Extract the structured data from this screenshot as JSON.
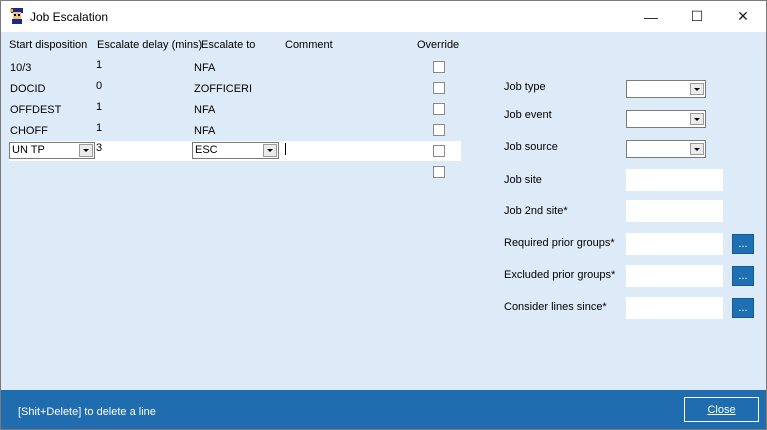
{
  "window": {
    "title": "Job Escalation",
    "controls": {
      "minimize": "—",
      "maximize": "☐",
      "close": "✕"
    }
  },
  "grid": {
    "headers": {
      "start_disposition": "Start disposition",
      "escalate_delay": "Escalate delay (mins)",
      "escalate_to": "Escalate to",
      "comment": "Comment",
      "override": "Override"
    },
    "rows": [
      {
        "start": "10/3",
        "delay": "1",
        "to": "NFA",
        "comment": "",
        "override": false
      },
      {
        "start": "DOCID",
        "delay": "0",
        "to": "ZOFFICERI",
        "comment": "",
        "override": false
      },
      {
        "start": "OFFDEST",
        "delay": "1",
        "to": "NFA",
        "comment": "",
        "override": false
      },
      {
        "start": "CHOFF",
        "delay": "1",
        "to": "NFA",
        "comment": "",
        "override": false
      }
    ],
    "edit_row": {
      "start": "UN TP",
      "delay": "3",
      "to": "ESC",
      "comment": "",
      "override": false
    },
    "new_row": {
      "override": false
    }
  },
  "filters": {
    "job_type": {
      "label": "Job type",
      "value": ""
    },
    "job_event": {
      "label": "Job event",
      "value": ""
    },
    "job_source": {
      "label": "Job source",
      "value": ""
    },
    "job_site": {
      "label": "Job site",
      "value": ""
    },
    "job_2nd_site": {
      "label": "Job 2nd site*",
      "value": ""
    },
    "required_prior_groups": {
      "label": "Required prior groups*",
      "value": "",
      "button": "..."
    },
    "excluded_prior_groups": {
      "label": "Excluded prior groups*",
      "value": "",
      "button": "..."
    },
    "consider_lines_since": {
      "label": "Consider lines since*",
      "value": "",
      "button": "..."
    }
  },
  "footer": {
    "hint": "[Shit+Delete] to delete a line",
    "close_label": "Close"
  },
  "colors": {
    "panel": "#ddeaf7",
    "footer": "#1f6cae",
    "button": "#1f6fb3"
  }
}
